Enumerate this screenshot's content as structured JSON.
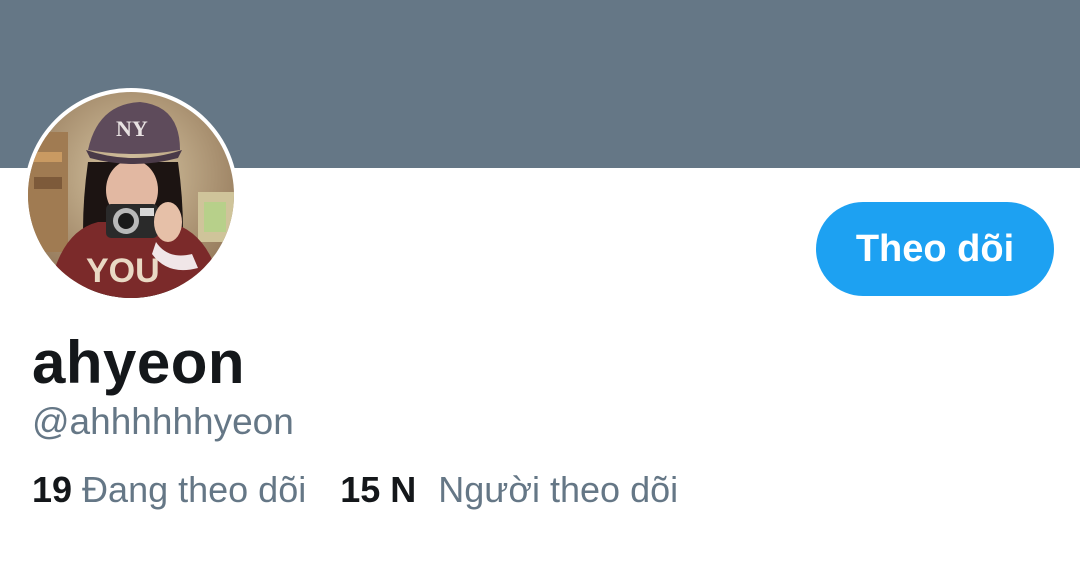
{
  "banner": {
    "color": "#657786"
  },
  "profile": {
    "avatar_icon": "profile-photo",
    "display_name": "ahyeon",
    "handle": "@ahhhhhhyeon"
  },
  "follow_button": {
    "label": "Theo dõi",
    "color": "#1da1f2"
  },
  "stats": {
    "following": {
      "count": "19",
      "label": "Đang theo dõi"
    },
    "followers": {
      "count": "15 N",
      "label": "Người theo dõi"
    }
  }
}
